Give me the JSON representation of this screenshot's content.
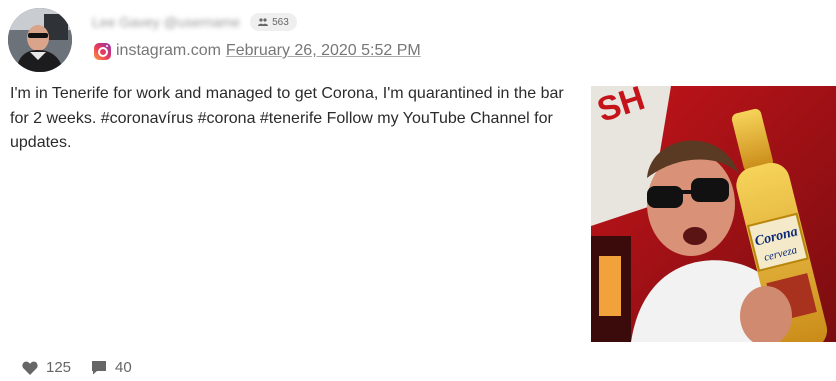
{
  "post": {
    "author_display": "Lee Gavey @username",
    "follower_count": "563",
    "source_domain": "instagram.com",
    "date": "February 26, 2020 5:52 PM",
    "text": "I'm in Tenerife for work and managed to get Corona, I'm quarantined in the bar for 2 weeks. #coronavírus #corona #tenerife Follow my YouTube Channel for updates.",
    "image": {
      "bottle_label": "Corona",
      "bottle_sub": "cerveza",
      "sign_text": "SH",
      "icon": "photo-bottle"
    }
  },
  "stats": {
    "likes": "125",
    "comments": "40"
  },
  "colors": {
    "instagram_gradient_start": "#f9a13b",
    "instagram_gradient_end": "#8a3ab9",
    "image_background": "#b01a1a",
    "muted_text": "#777777"
  },
  "icons": {
    "followers": "people-icon",
    "source": "instagram-icon",
    "likes": "heart-icon",
    "comments": "comment-icon"
  }
}
